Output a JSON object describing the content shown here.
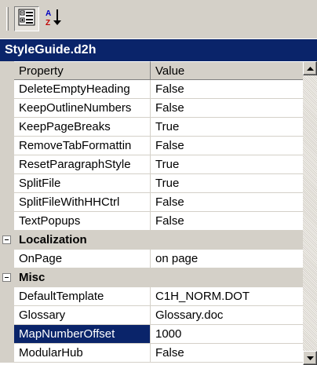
{
  "toolbar": {
    "categorized_icon": "categorized-view-icon",
    "alphabetical_icon": "alphabetical-sort-icon"
  },
  "title": "StyleGuide.d2h",
  "header": {
    "name": "Property",
    "value": "Value"
  },
  "rows": [
    {
      "kind": "prop",
      "name": "DeleteEmptyHeading",
      "value": "False"
    },
    {
      "kind": "prop",
      "name": "KeepOutlineNumbers",
      "value": "False"
    },
    {
      "kind": "prop",
      "name": "KeepPageBreaks",
      "value": "True"
    },
    {
      "kind": "prop",
      "name": "RemoveTabFormattin",
      "value": "False"
    },
    {
      "kind": "prop",
      "name": "ResetParagraphStyle",
      "value": "True"
    },
    {
      "kind": "prop",
      "name": "SplitFile",
      "value": "True"
    },
    {
      "kind": "prop",
      "name": "SplitFileWithHHCtrl",
      "value": "False"
    },
    {
      "kind": "prop",
      "name": "TextPopups",
      "value": "False"
    },
    {
      "kind": "category",
      "name": "Localization",
      "value": ""
    },
    {
      "kind": "prop",
      "name": "OnPage",
      "value": "on page"
    },
    {
      "kind": "category",
      "name": "Misc",
      "value": ""
    },
    {
      "kind": "prop",
      "name": "DefaultTemplate",
      "value": "C1H_NORM.DOT"
    },
    {
      "kind": "prop",
      "name": "Glossary",
      "value": "Glossary.doc"
    },
    {
      "kind": "prop",
      "name": "MapNumberOffset",
      "value": "1000",
      "selected": true
    },
    {
      "kind": "prop",
      "name": "ModularHub",
      "value": "False"
    }
  ],
  "colors": {
    "selection": "#0a246a",
    "face": "#d4d0c8"
  }
}
